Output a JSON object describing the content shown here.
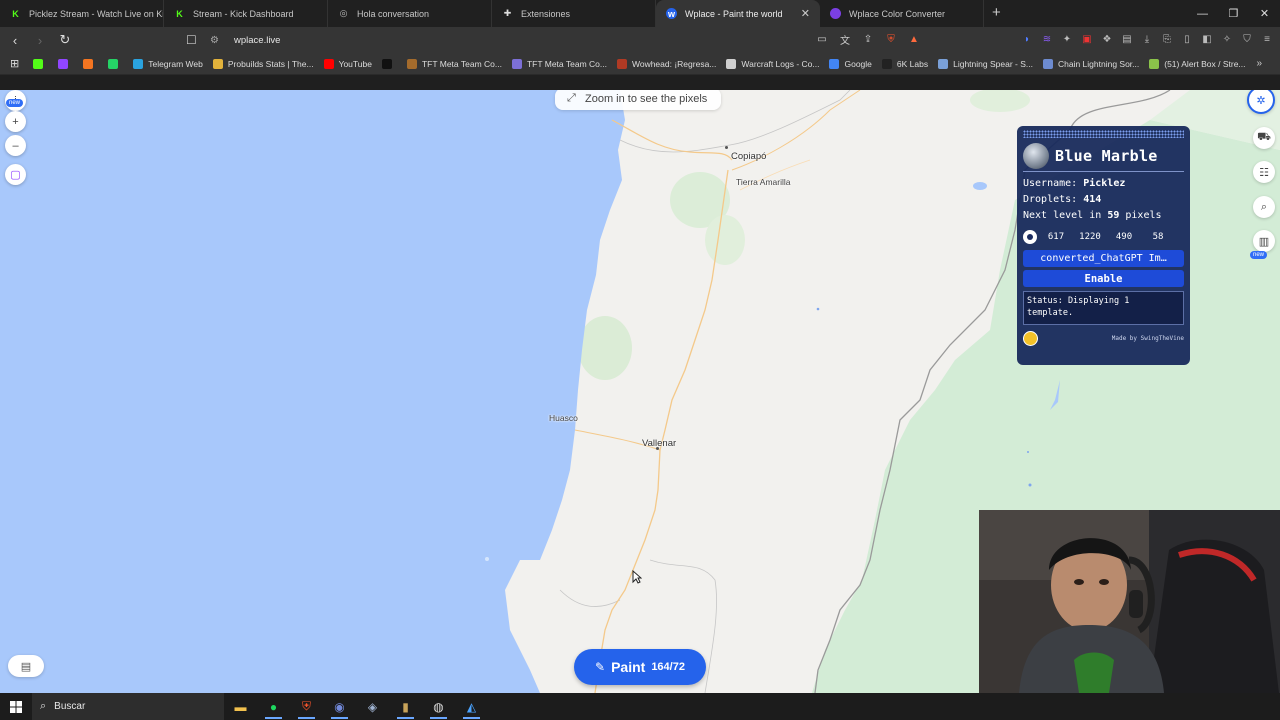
{
  "tabs": [
    {
      "label": "Picklez Stream - Watch Live on Kick",
      "icon": "kick-icon",
      "color": "#53fc18",
      "active": false
    },
    {
      "label": "Stream - Kick Dashboard",
      "icon": "kick-icon",
      "color": "#53fc18",
      "active": false
    },
    {
      "label": "Hola conversation",
      "icon": "chat-icon",
      "color": "#bbbbbb",
      "active": false
    },
    {
      "label": "Extensiones",
      "icon": "puzzle-icon",
      "color": "#dddddd",
      "active": false
    },
    {
      "label": "Wplace - Paint the world",
      "icon": "wplace-icon",
      "color": "#2563eb",
      "active": true
    },
    {
      "label": "Wplace Color Converter",
      "icon": "converter-icon",
      "color": "#7b3fe4",
      "active": false
    }
  ],
  "address_bar": {
    "url": "wplace.live"
  },
  "bookmarks": [
    {
      "label": "",
      "icon": "kick-icon",
      "color": "#53fc18"
    },
    {
      "label": "",
      "icon": "twitch-icon",
      "color": "#9146ff"
    },
    {
      "label": "",
      "icon": "crunchyroll-icon",
      "color": "#f47521"
    },
    {
      "label": "",
      "icon": "whatsapp-icon",
      "color": "#25d366"
    },
    {
      "label": "Telegram Web",
      "icon": "telegram-icon",
      "color": "#2aa3df"
    },
    {
      "label": "Probuilds Stats | The...",
      "icon": "probuilds-icon",
      "color": "#e2b23b"
    },
    {
      "label": "YouTube",
      "icon": "youtube-icon",
      "color": "#ff0000"
    },
    {
      "label": "",
      "icon": "x-icon",
      "color": "#111111"
    },
    {
      "label": "TFT Meta Team Co...",
      "icon": "tft-icon",
      "color": "#a46b2c"
    },
    {
      "label": "TFT Meta Team Co...",
      "icon": "tft-icon",
      "color": "#7c6fd6"
    },
    {
      "label": "Wowhead: ¡Regresa...",
      "icon": "wowhead-icon",
      "color": "#b03a24"
    },
    {
      "label": "Warcraft Logs - Co...",
      "icon": "warcraftlogs-icon",
      "color": "#cfcfcf"
    },
    {
      "label": "Google",
      "icon": "google-icon",
      "color": "#4285f4"
    },
    {
      "label": "6K Labs",
      "icon": "6klabs-icon",
      "color": "#222222"
    },
    {
      "label": "Lightning Spear - S...",
      "icon": "wow-icon",
      "color": "#7aa0d8"
    },
    {
      "label": "Chain Lightning Sor...",
      "icon": "wow-icon",
      "color": "#6d8bd0"
    },
    {
      "label": "(51) Alert Box / Stre...",
      "icon": "streamelements-icon",
      "color": "#8bc34a"
    }
  ],
  "map": {
    "zoom_hint": "Zoom in to see the pixels",
    "labels": {
      "copiapo": "Copiapó",
      "tierra_amarilla": "Tierra Amarilla",
      "huasco": "Huasco",
      "vallenar": "Vallenar"
    },
    "new_badge": "new",
    "paint": {
      "label": "Paint",
      "count": "164/72"
    }
  },
  "blue_marble": {
    "title": "Blue Marble",
    "username_label": "Username:",
    "username": "Picklez",
    "droplets_label": "Droplets:",
    "droplets": "414",
    "next_level_prefix": "Next level in",
    "next_level_pixels": "59",
    "next_level_suffix": "pixels",
    "coords": [
      "617",
      "1220",
      "490",
      "58"
    ],
    "file_button": "converted_ChatGPT Im…",
    "enable_button": "Enable",
    "status": "Status: Displaying 1 template.",
    "made_by": "Made by SwingTheVine"
  },
  "taskbar": {
    "search_placeholder": "Buscar",
    "apps": [
      "file-explorer-icon",
      "spotify-icon",
      "brave-icon",
      "discord-icon",
      "steam-icon",
      "app-icon",
      "obs-icon",
      "wplace-icon"
    ]
  },
  "colors": {
    "ocean": "#a8c8fb",
    "land": "#f2f1ee",
    "accent": "#2563eb",
    "panel": "#16285a"
  }
}
